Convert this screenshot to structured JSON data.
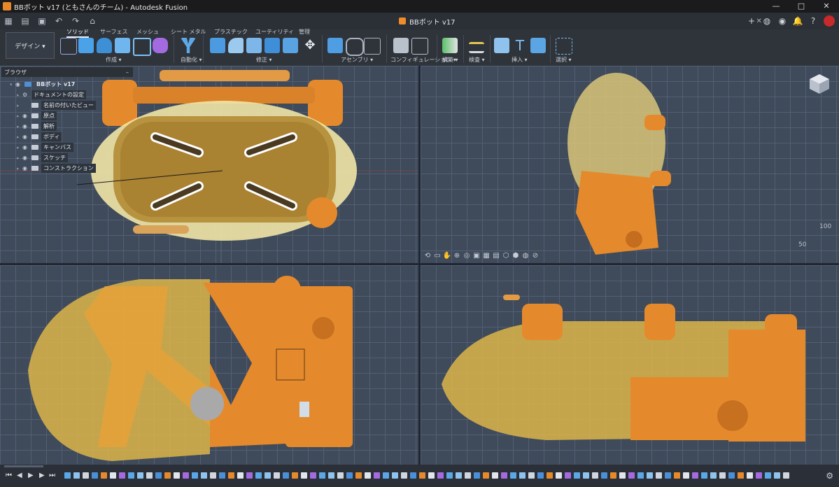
{
  "window": {
    "title": "BBボット v17 (ともさんのチーム) - Autodesk Fusion",
    "controls": [
      "—",
      "□",
      "✕"
    ]
  },
  "document_tab": {
    "label": "BBボット v17"
  },
  "workspace": {
    "label": "デザイン ▾"
  },
  "ribbon": {
    "tabs": [
      "ソリッド",
      "サーフェス",
      "メッシュ",
      "シート メタル",
      "プラスチック",
      "ユーティリティ",
      "管理"
    ],
    "active_tab": "ソリッド",
    "groups": [
      "作成 ▾",
      "自動化 ▾",
      "修正 ▾",
      "アセンブリ ▾",
      "コンフィギュレーション ▾",
      "構築 ▾",
      "検査 ▾",
      "挿入 ▾",
      "選択 ▾"
    ]
  },
  "browser": {
    "header": "ブラウザ",
    "collapse": "–",
    "root": "BBボット v17",
    "items": [
      "ドキュメントの設定",
      "名前の付いたビュー",
      "原点",
      "解析",
      "ボディ",
      "キャンバス",
      "スケッチ",
      "コンストラクション"
    ]
  },
  "viewport_labels": {
    "grid_labels": [
      "100",
      "50"
    ]
  },
  "colors": {
    "orange": "#e58a2c",
    "yellow_shell": "#e8c867",
    "accent_avatar": "#c62a2a"
  },
  "icons": {
    "close": "✕",
    "play": "▶",
    "gear": "⚙"
  }
}
